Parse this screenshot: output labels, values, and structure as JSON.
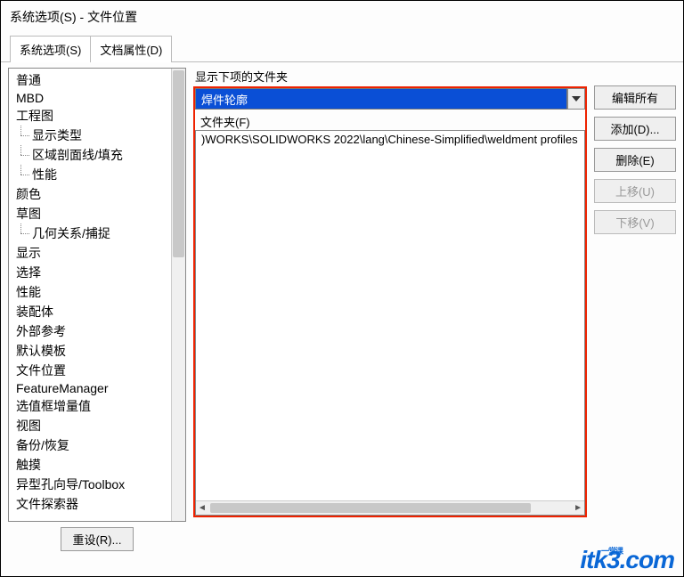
{
  "title": "系统选项(S) - 文件位置",
  "tabs": [
    {
      "label": "系统选项(S)",
      "active": true
    },
    {
      "label": "文档属性(D)",
      "active": false
    }
  ],
  "tree": [
    {
      "label": "普通",
      "indent": 0
    },
    {
      "label": "MBD",
      "indent": 0
    },
    {
      "label": "工程图",
      "indent": 0
    },
    {
      "label": "显示类型",
      "indent": 1
    },
    {
      "label": "区域剖面线/填充",
      "indent": 1
    },
    {
      "label": "性能",
      "indent": 1,
      "last": true
    },
    {
      "label": "颜色",
      "indent": 0
    },
    {
      "label": "草图",
      "indent": 0
    },
    {
      "label": "几何关系/捕捉",
      "indent": 1,
      "last": true
    },
    {
      "label": "显示",
      "indent": 0
    },
    {
      "label": "选择",
      "indent": 0
    },
    {
      "label": "性能",
      "indent": 0
    },
    {
      "label": "装配体",
      "indent": 0
    },
    {
      "label": "外部参考",
      "indent": 0
    },
    {
      "label": "默认模板",
      "indent": 0
    },
    {
      "label": "文件位置",
      "indent": 0
    },
    {
      "label": "FeatureManager",
      "indent": 0
    },
    {
      "label": "选值框增量值",
      "indent": 0
    },
    {
      "label": "视图",
      "indent": 0
    },
    {
      "label": "备份/恢复",
      "indent": 0
    },
    {
      "label": "触摸",
      "indent": 0
    },
    {
      "label": "异型孔向导/Toolbox",
      "indent": 0
    },
    {
      "label": "文件探索器",
      "indent": 0
    }
  ],
  "resetLabel": "重设(R)...",
  "mid": {
    "showLabel": "显示下项的文件夹",
    "dropdownValue": "焊件轮廓",
    "folderLabel": "文件夹(F)",
    "folderPath": ")WORKS\\SOLIDWORKS 2022\\lang\\Chinese-Simplified\\weldment profiles"
  },
  "buttons": {
    "editAll": "编辑所有",
    "add": "添加(D)...",
    "delete": "删除(E)",
    "moveUp": "上移(U)",
    "moveDown": "下移(V)"
  },
  "watermark": {
    "brand": "itk3",
    "suffix": ".com",
    "sub": "一堂课"
  }
}
